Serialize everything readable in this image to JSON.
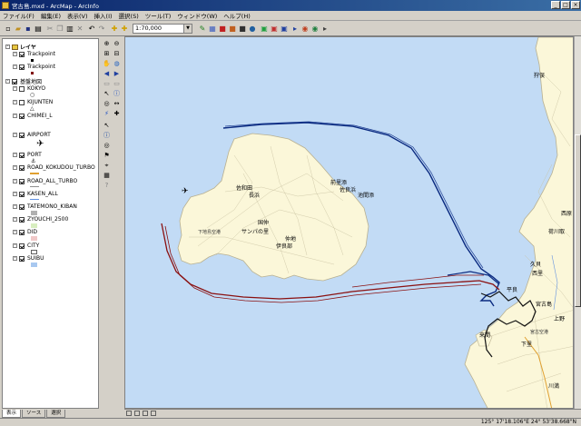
{
  "window": {
    "title": "宮古島.mxd - ArcMap - ArcInfo"
  },
  "menu": [
    "ファイル(F)",
    "編集(E)",
    "表示(V)",
    "挿入(I)",
    "選択(S)",
    "ツール(T)",
    "ウィンドウ(W)",
    "ヘルプ(H)"
  ],
  "toolbar": {
    "scale": "1:70,000"
  },
  "toc": {
    "root": "レイヤ",
    "layers": [
      {
        "name": "Trackpoint",
        "checked": true
      },
      {
        "name": "Trackpoint",
        "checked": true
      },
      {
        "name": "基盤地図",
        "checked": true
      },
      {
        "name": "KOKYO",
        "checked": false
      },
      {
        "name": "KIJUNTEN",
        "checked": false
      },
      {
        "name": "CHIMEI_L",
        "checked": true
      },
      {
        "name": "AIRPORT",
        "checked": true
      },
      {
        "name": "PORT",
        "checked": true
      },
      {
        "name": "ROAD_KOKUDOU_TURBO",
        "checked": true
      },
      {
        "name": "ROAD_ALL_TURBO",
        "checked": true
      },
      {
        "name": "KASEN_ALL",
        "checked": true
      },
      {
        "name": "TATEMONO_KIBAN",
        "checked": true
      },
      {
        "name": "ZYOUCHI_2500",
        "checked": true
      },
      {
        "name": "DID",
        "checked": true
      },
      {
        "name": "CITY",
        "checked": true
      },
      {
        "name": "SUIBU",
        "checked": true
      }
    ],
    "tabs": [
      "表示",
      "ソース",
      "選択"
    ]
  },
  "map": {
    "labels": [
      "佐和田",
      "長浜",
      "前里添",
      "佐良浜",
      "池間添",
      "国仲",
      "サンパの里",
      "伊良部",
      "仲地",
      "下地島空港",
      "狩俣",
      "西原",
      "荷川取",
      "久貝",
      "来間",
      "上野",
      "平良",
      "西里",
      "下里",
      "宮古島",
      "宮古空港",
      "川満"
    ]
  },
  "status": {
    "coords": "125° 17'18.106\"E  24° 53'38.668\"N"
  },
  "colors": {
    "sea": "#c2dbf5",
    "land": "#fbf7d9",
    "track_blue": "#0a2a80",
    "track_red": "#8a1010"
  }
}
